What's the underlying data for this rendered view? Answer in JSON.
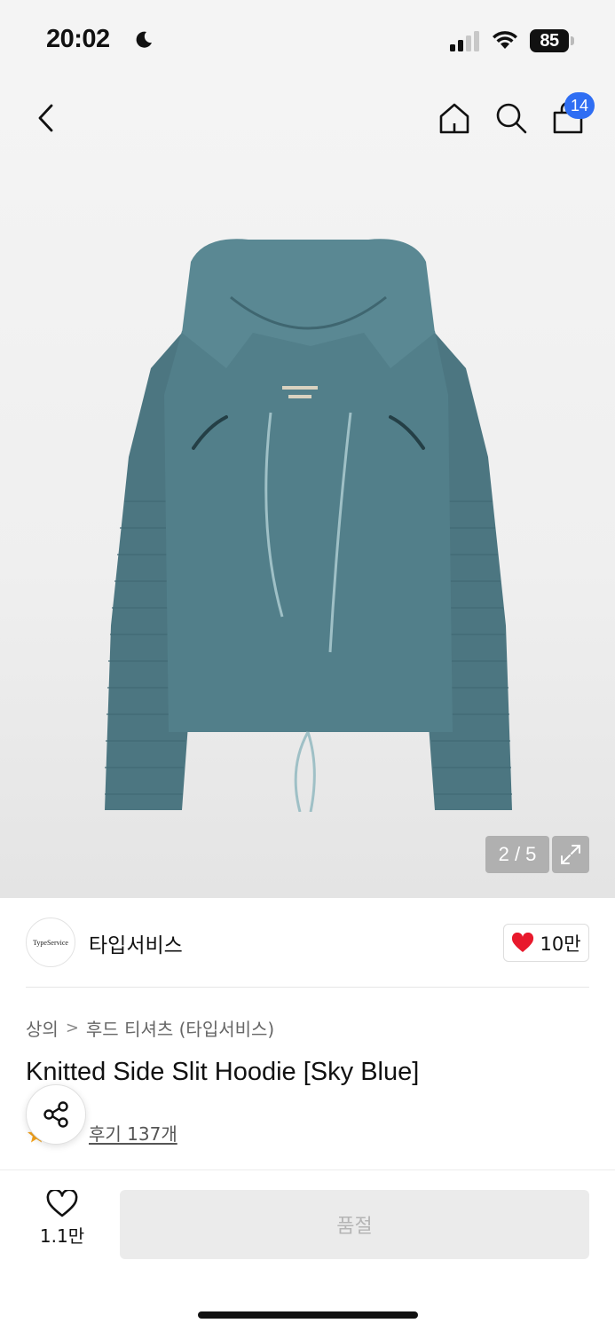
{
  "status_bar": {
    "time": "20:02",
    "battery": "85"
  },
  "header": {
    "cart_badge": "14",
    "icons": [
      "back-icon",
      "home-icon",
      "search-icon",
      "cart-icon"
    ]
  },
  "gallery": {
    "counter": "2 / 5",
    "current_image": 2,
    "total_images": 5
  },
  "brand": {
    "logo_text": "TypeService",
    "name": "타입서비스",
    "like_count": "10만"
  },
  "product": {
    "breadcrumb": [
      "상의",
      "후드 티셔츠 (타입서비스)"
    ],
    "breadcrumb_separator": ">",
    "title": "Knitted Side Slit Hoodie [Sky Blue]",
    "review_link": "후기 137개"
  },
  "bottom_bar": {
    "wish_count": "1.1만",
    "soldout_label": "품절"
  },
  "colors": {
    "accent_blue": "#2f6ef3",
    "heart_red": "#e8192c",
    "hoodie": "#527f8a",
    "star": "#f3a21b"
  }
}
